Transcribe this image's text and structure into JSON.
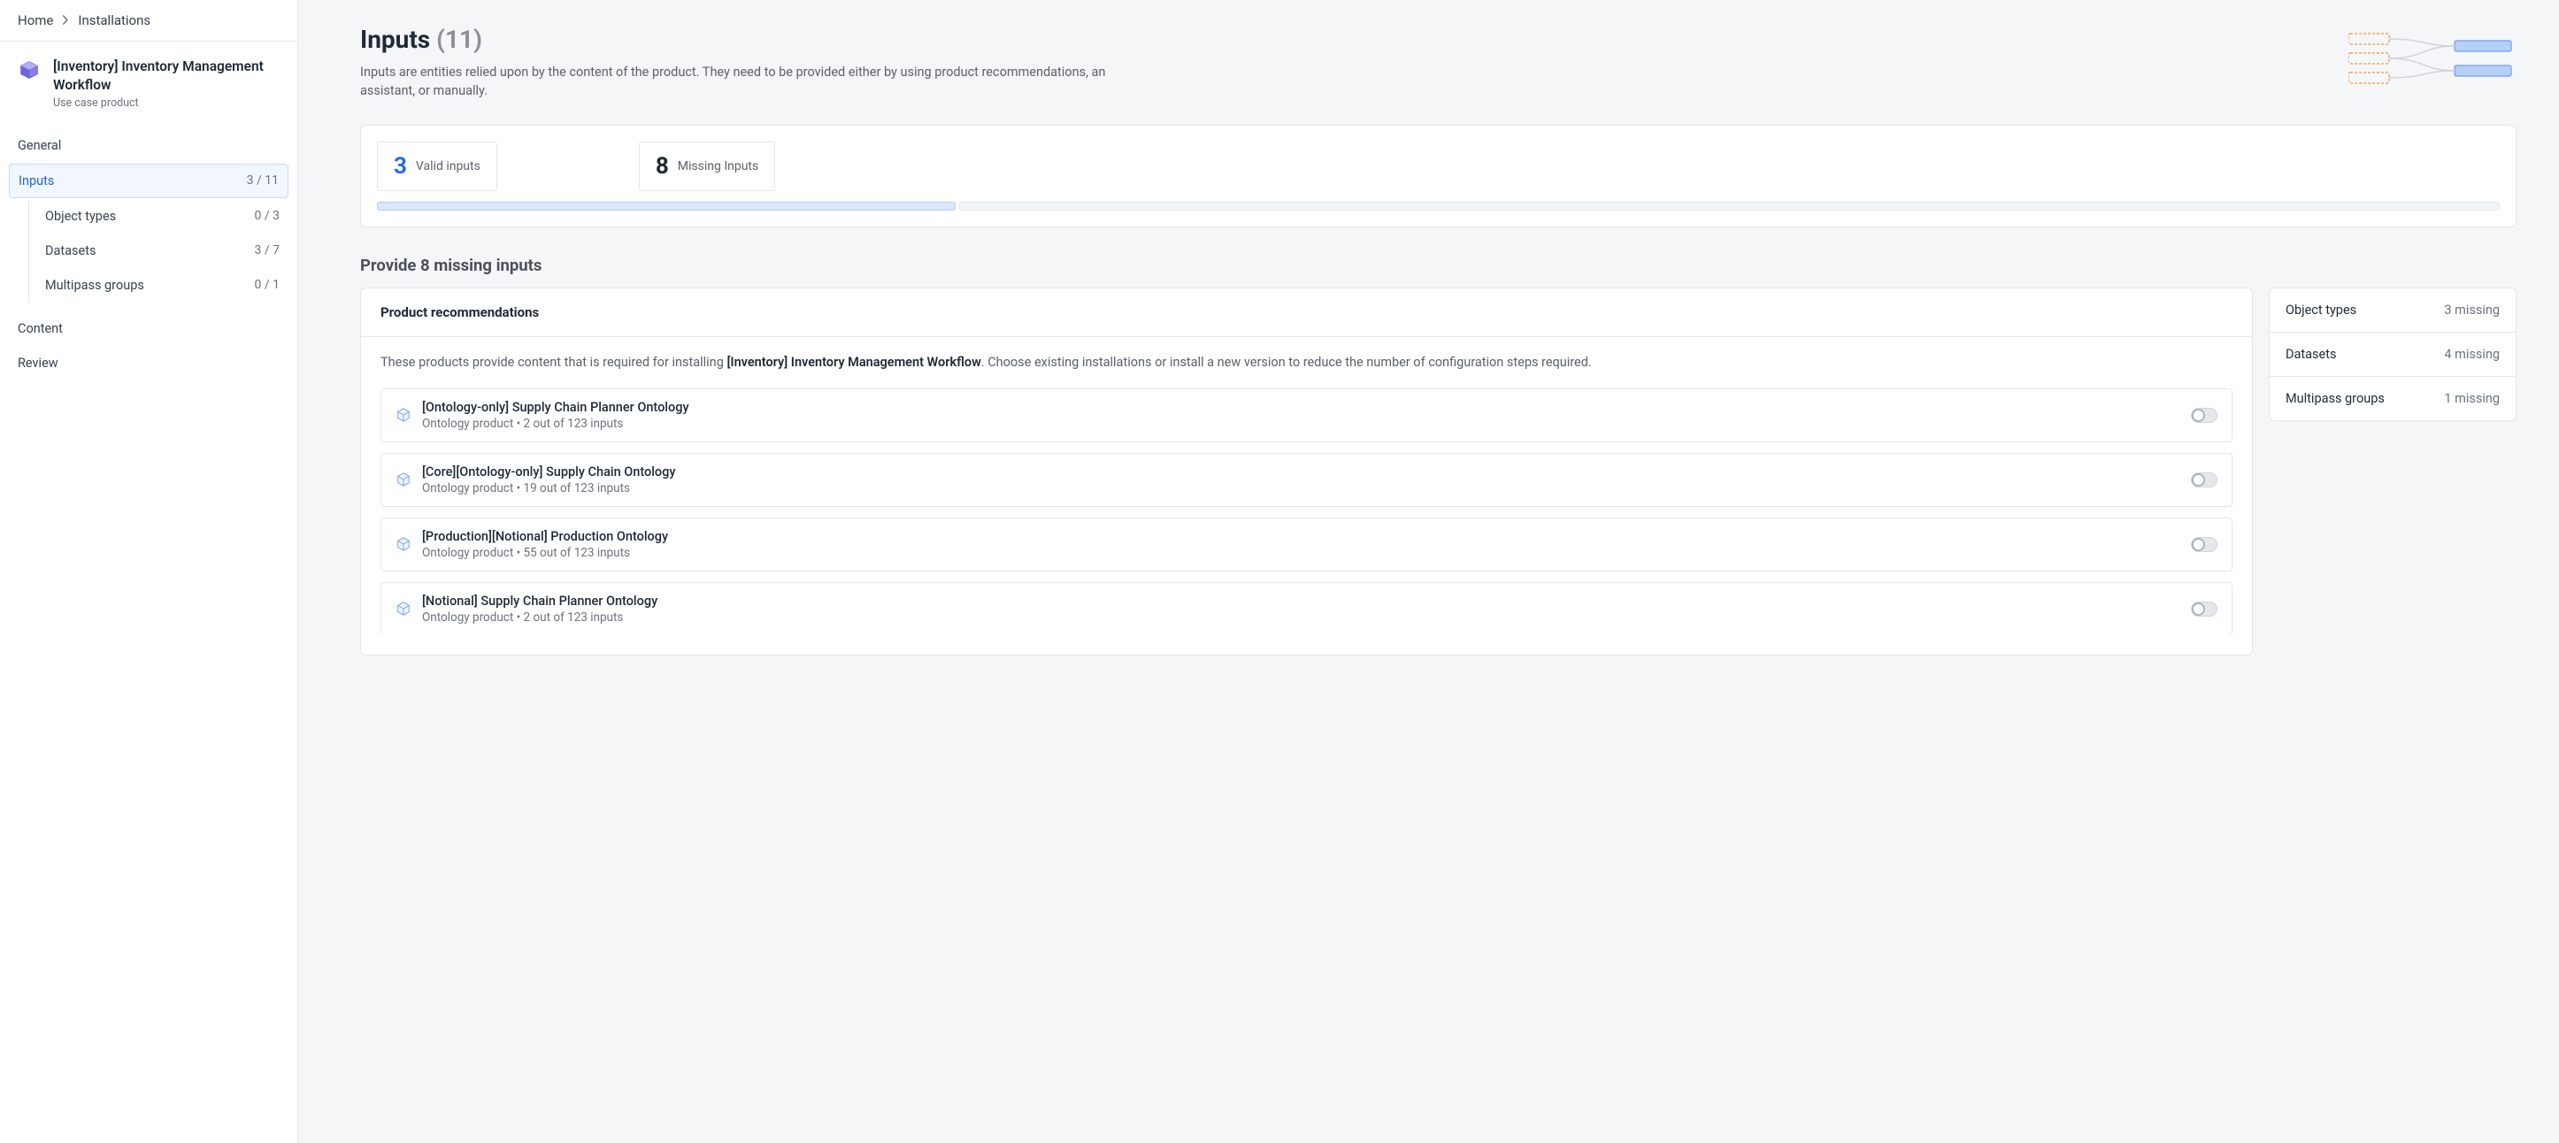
{
  "breadcrumb": {
    "home": "Home",
    "installations": "Installations"
  },
  "product": {
    "title": "[Inventory] Inventory Management Workflow",
    "subtitle": "Use case product"
  },
  "nav": {
    "general": "General",
    "inputs": {
      "label": "Inputs",
      "count": "3 / 11"
    },
    "object_types": {
      "label": "Object types",
      "count": "0 / 3"
    },
    "datasets": {
      "label": "Datasets",
      "count": "3 / 7"
    },
    "multipass": {
      "label": "Multipass groups",
      "count": "0 / 1"
    },
    "content": "Content",
    "review": "Review"
  },
  "page": {
    "title": "Inputs",
    "title_count": "(11)",
    "desc": "Inputs are entities relied upon by the content of the product. They need to be provided either by using product recommendations, an assistant, or manually."
  },
  "stats": {
    "valid": {
      "num": "3",
      "label": "Valid inputs"
    },
    "missing": {
      "num": "8",
      "label": "Missing Inputs"
    }
  },
  "missing_section_title": "Provide 8 missing inputs",
  "recommendations": {
    "header": "Product recommendations",
    "desc_prefix": "These products provide content that is required for installing ",
    "desc_bold": "[Inventory] Inventory Management Workflow",
    "desc_suffix": ". Choose existing installations or install a new version to reduce the number of configuration steps required.",
    "items": [
      {
        "name": "[Ontology-only] Supply Chain Planner Ontology",
        "sub": "Ontology product  •  2 out of 123 inputs"
      },
      {
        "name": "[Core][Ontology-only] Supply Chain Ontology",
        "sub": "Ontology product  •  19 out of 123 inputs"
      },
      {
        "name": "[Production][Notional] Production Ontology",
        "sub": "Ontology product  •  55 out of 123 inputs"
      },
      {
        "name": "[Notional] Supply Chain Planner Ontology",
        "sub": "Ontology product  •  2 out of 123 inputs"
      }
    ]
  },
  "missing_summary": [
    {
      "label": "Object types",
      "val": "3 missing"
    },
    {
      "label": "Datasets",
      "val": "4 missing"
    },
    {
      "label": "Multipass groups",
      "val": "1 missing"
    }
  ]
}
